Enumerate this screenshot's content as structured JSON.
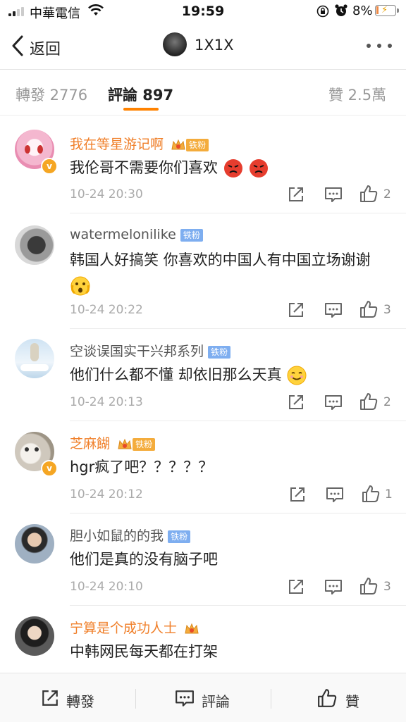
{
  "status": {
    "carrier": "中華電信",
    "time": "19:59",
    "battery": "8%"
  },
  "nav": {
    "back_label": "返回",
    "title": "1X1X"
  },
  "tabs": [
    {
      "label": "轉發 2776"
    },
    {
      "label": "評論 897"
    },
    {
      "label": "贊 2.5萬"
    }
  ],
  "comments": [
    {
      "name": "我在等星游记啊",
      "tag": "铁粉",
      "text": "我伦哥不需要你们喜欢",
      "time": "10-24 20:30",
      "likes": "2"
    },
    {
      "name": "watermelonilike",
      "tag": "铁粉",
      "text": "韩国人好搞笑 你喜欢的中国人有中国立场谢谢",
      "time": "10-24 20:22",
      "likes": "3"
    },
    {
      "name": "空谈误国实干兴邦系列",
      "tag": "铁粉",
      "text": "他们什么都不懂 却依旧那么天真",
      "time": "10-24 20:13",
      "likes": "2"
    },
    {
      "name": "芝麻餬",
      "tag": "铁粉",
      "text": "hgr疯了吧？？？？？",
      "time": "10-24 20:12",
      "likes": "1"
    },
    {
      "name": "胆小如鼠的的我",
      "tag": "铁粉",
      "text": "他们是真的没有脑子吧",
      "time": "10-24 20:10",
      "likes": "3"
    },
    {
      "name": "宁算是个成功人士",
      "text": "中韩网民每天都在打架"
    }
  ],
  "bottom": {
    "repost": "轉發",
    "comment": "評論",
    "like": "贊"
  },
  "colors": {
    "accent": "#ff8200",
    "vip_name": "#f0802b",
    "fan_tag_blue": "#7eaef0",
    "fan_tag_gold": "#f4ac3c"
  }
}
